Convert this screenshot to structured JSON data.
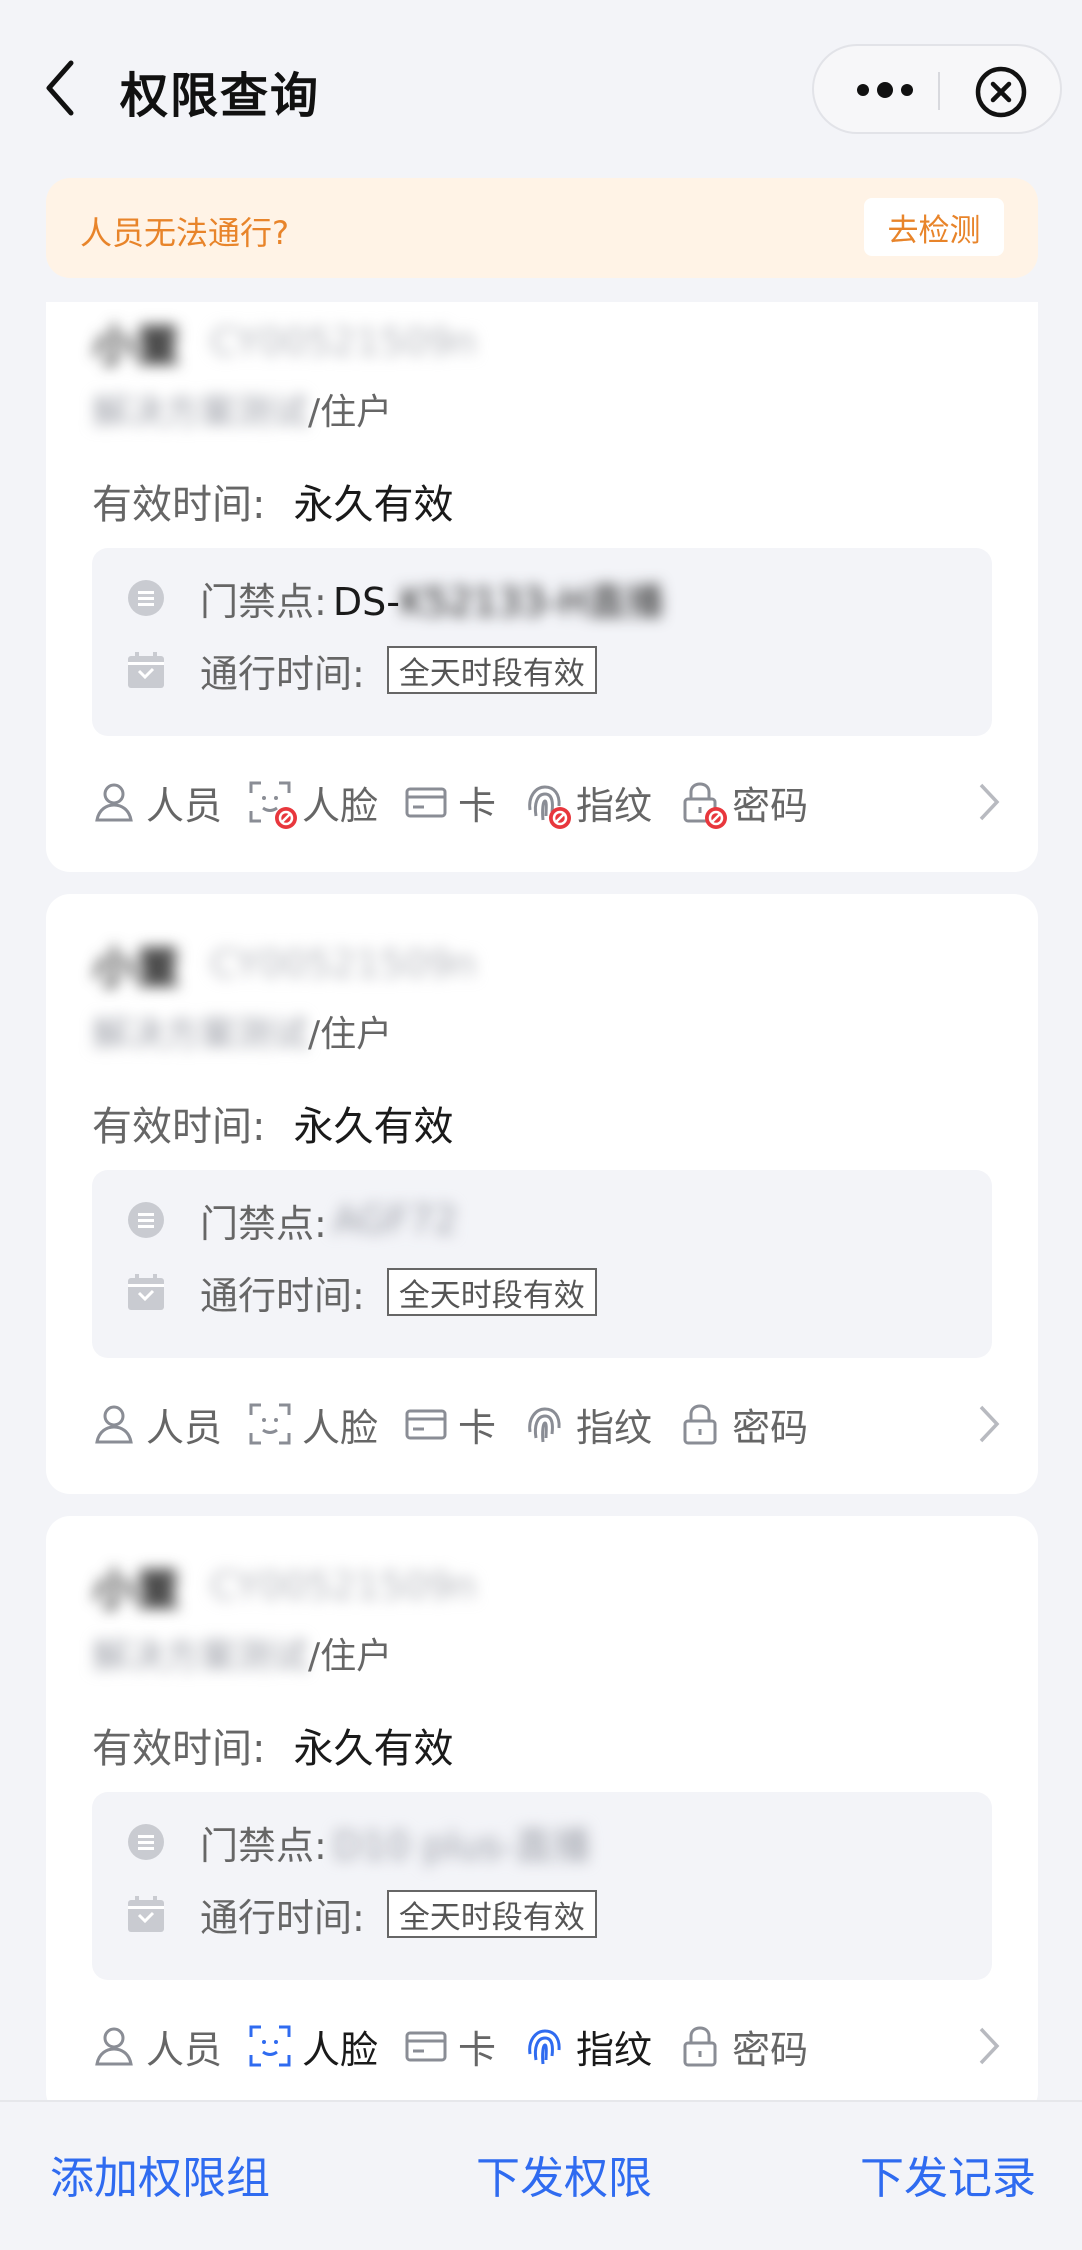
{
  "header": {
    "title": "权限查询"
  },
  "banner": {
    "text": "人员无法通行?",
    "button_label": "去检测"
  },
  "cards": [
    {
      "name": "小董",
      "user_id": "CY00521509n",
      "department": "解决方案测试",
      "role": "/住户",
      "validity_label": "有效时间:",
      "validity_value": "永久有效",
      "door_label": "门禁点:",
      "door_prefix": "DS-",
      "door_rest": "K52133-H直播",
      "pass_time_label": "通行时间:",
      "pass_time_tag": "全天时段有效",
      "credentials": [
        {
          "label": "人员",
          "icon": "person-icon",
          "state": "normal"
        },
        {
          "label": "人脸",
          "icon": "face-icon",
          "state": "banned"
        },
        {
          "label": "卡",
          "icon": "card-icon",
          "state": "normal"
        },
        {
          "label": "指纹",
          "icon": "fingerprint-icon",
          "state": "banned"
        },
        {
          "label": "密码",
          "icon": "lock-icon",
          "state": "banned"
        }
      ]
    },
    {
      "name": "小董",
      "user_id": "CY00521509n",
      "department": "解决方案测试",
      "role": "/住户",
      "validity_label": "有效时间:",
      "validity_value": "永久有效",
      "door_label": "门禁点:",
      "door_prefix": "",
      "door_rest": "AGF72",
      "pass_time_label": "通行时间:",
      "pass_time_tag": "全天时段有效",
      "credentials": [
        {
          "label": "人员",
          "icon": "person-icon",
          "state": "normal"
        },
        {
          "label": "人脸",
          "icon": "face-icon",
          "state": "normal"
        },
        {
          "label": "卡",
          "icon": "card-icon",
          "state": "normal"
        },
        {
          "label": "指纹",
          "icon": "fingerprint-icon",
          "state": "normal"
        },
        {
          "label": "密码",
          "icon": "lock-icon",
          "state": "normal"
        }
      ]
    },
    {
      "name": "小董",
      "user_id": "CY00521509n",
      "department": "解决方案测试",
      "role": "/住户",
      "validity_label": "有效时间:",
      "validity_value": "永久有效",
      "door_label": "门禁点:",
      "door_prefix": "",
      "door_rest": "D10 plus-直播",
      "pass_time_label": "通行时间:",
      "pass_time_tag": "全天时段有效",
      "credentials": [
        {
          "label": "人员",
          "icon": "person-icon",
          "state": "normal"
        },
        {
          "label": "人脸",
          "icon": "face-icon",
          "state": "active"
        },
        {
          "label": "卡",
          "icon": "card-icon",
          "state": "normal"
        },
        {
          "label": "指纹",
          "icon": "fingerprint-icon",
          "state": "active"
        },
        {
          "label": "密码",
          "icon": "lock-icon",
          "state": "normal"
        }
      ]
    }
  ],
  "bottom_bar": {
    "add_group": "添加权限组",
    "issue_permission": "下发权限",
    "issue_record": "下发记录"
  },
  "colors": {
    "accent_blue": "#2f6bf0",
    "warning_orange": "#e8842a",
    "ban_red": "#e8373d",
    "background": "#f3f4f8"
  }
}
